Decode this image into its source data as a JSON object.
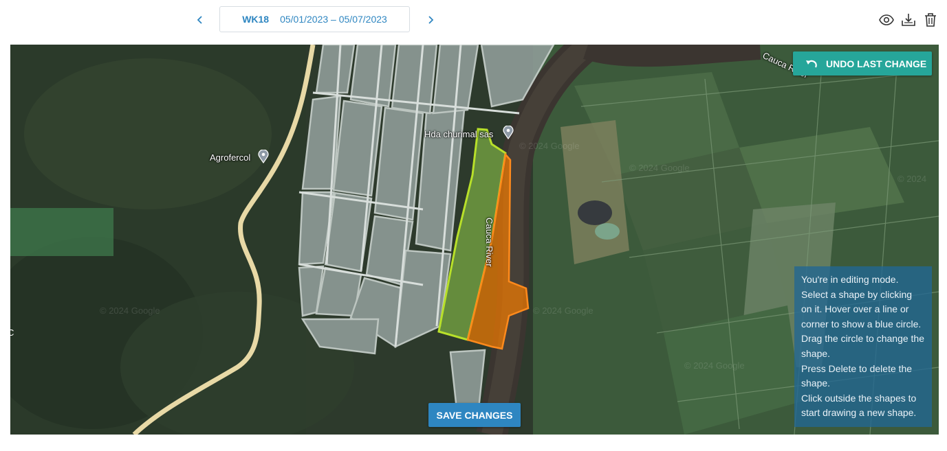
{
  "week": {
    "label": "WK18",
    "range": "05/01/2023 – 05/07/2023"
  },
  "toolbar": {
    "prev_icon": "chevron-left-icon",
    "next_icon": "chevron-right-icon",
    "view_icon": "eye-icon",
    "download_icon": "download-icon",
    "delete_icon": "trash-icon",
    "accent_color": "#2e86c1"
  },
  "map": {
    "labels": {
      "agrofercol": "Agrofercol",
      "hda": "Hda churimal sas",
      "river_vertical": "Cauca River",
      "river_top": "Cauca River",
      "edge_char": "C"
    },
    "shapes": [
      {
        "name": "selected-field",
        "fill": "#8bc34a",
        "stroke": "#9ccc3a"
      },
      {
        "name": "new-field",
        "fill": "#f57c00",
        "stroke": "#ff8a1c"
      }
    ]
  },
  "buttons": {
    "undo": "UNDO LAST CHANGE",
    "undo_color": "#26a69a",
    "save": "SAVE CHANGES",
    "save_color": "#2e86c1"
  },
  "help": {
    "lines": [
      "You're in editing mode.",
      "Select a shape by clicking on it. Hover over a line or corner to show a blue circle.",
      "Drag the circle to change the shape.",
      "Press Delete to delete the shape.",
      "Click outside the shapes to start drawing a new shape."
    ]
  }
}
